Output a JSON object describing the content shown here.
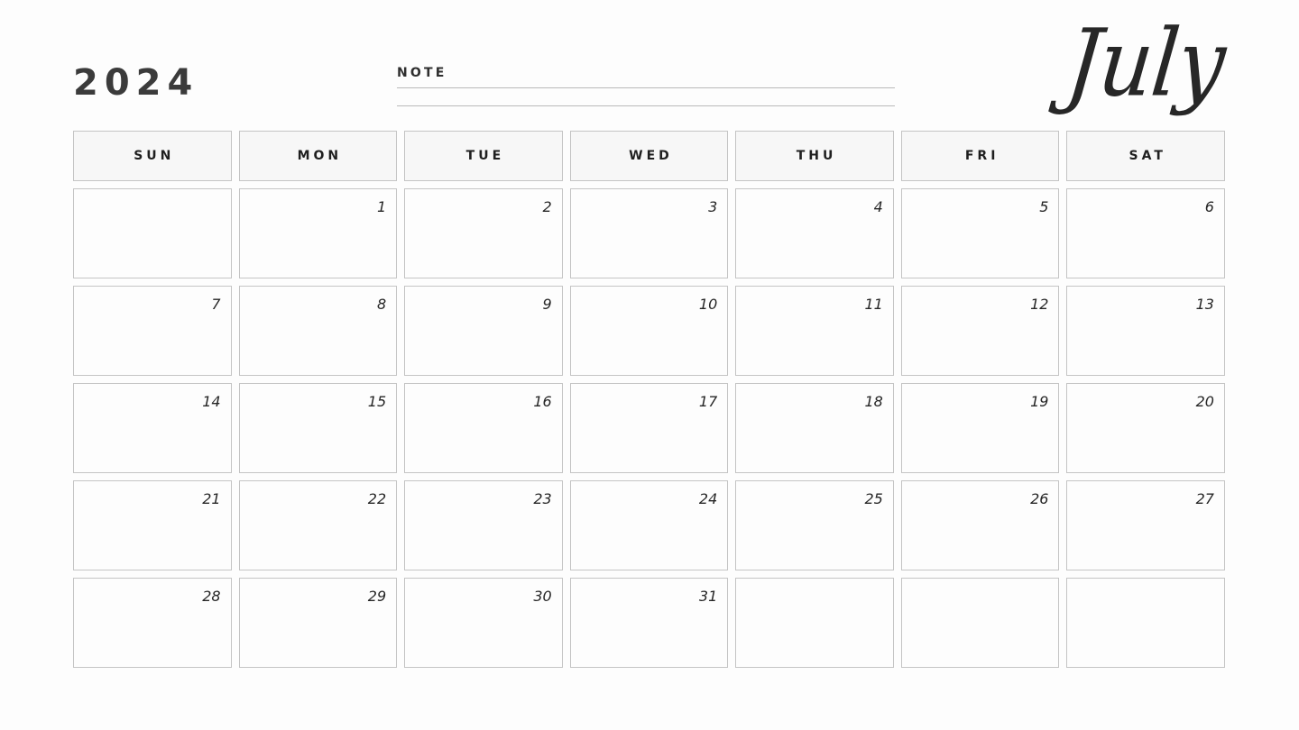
{
  "header": {
    "year": "2024",
    "month": "July",
    "note_label": "NOTE",
    "note_lines": [
      "",
      ""
    ]
  },
  "calendar": {
    "weekdays": [
      "SUN",
      "MON",
      "TUE",
      "WED",
      "THU",
      "FRI",
      "SAT"
    ],
    "weeks": [
      [
        {
          "day": ""
        },
        {
          "day": "1"
        },
        {
          "day": "2"
        },
        {
          "day": "3"
        },
        {
          "day": "4"
        },
        {
          "day": "5"
        },
        {
          "day": "6"
        }
      ],
      [
        {
          "day": "7"
        },
        {
          "day": "8"
        },
        {
          "day": "9"
        },
        {
          "day": "10"
        },
        {
          "day": "11"
        },
        {
          "day": "12"
        },
        {
          "day": "13"
        }
      ],
      [
        {
          "day": "14"
        },
        {
          "day": "15"
        },
        {
          "day": "16"
        },
        {
          "day": "17"
        },
        {
          "day": "18"
        },
        {
          "day": "19"
        },
        {
          "day": "20"
        }
      ],
      [
        {
          "day": "21"
        },
        {
          "day": "22"
        },
        {
          "day": "23"
        },
        {
          "day": "24"
        },
        {
          "day": "25"
        },
        {
          "day": "26"
        },
        {
          "day": "27"
        }
      ],
      [
        {
          "day": "28"
        },
        {
          "day": "29"
        },
        {
          "day": "30"
        },
        {
          "day": "31"
        },
        {
          "day": ""
        },
        {
          "day": ""
        },
        {
          "day": ""
        }
      ]
    ]
  },
  "colors": {
    "page_background": "#fdfdfd",
    "cell_border": "#c4c4c4",
    "header_cell_fill": "#f7f7f7",
    "text_dark": "#262626",
    "note_rule": "#b9b9b9"
  }
}
